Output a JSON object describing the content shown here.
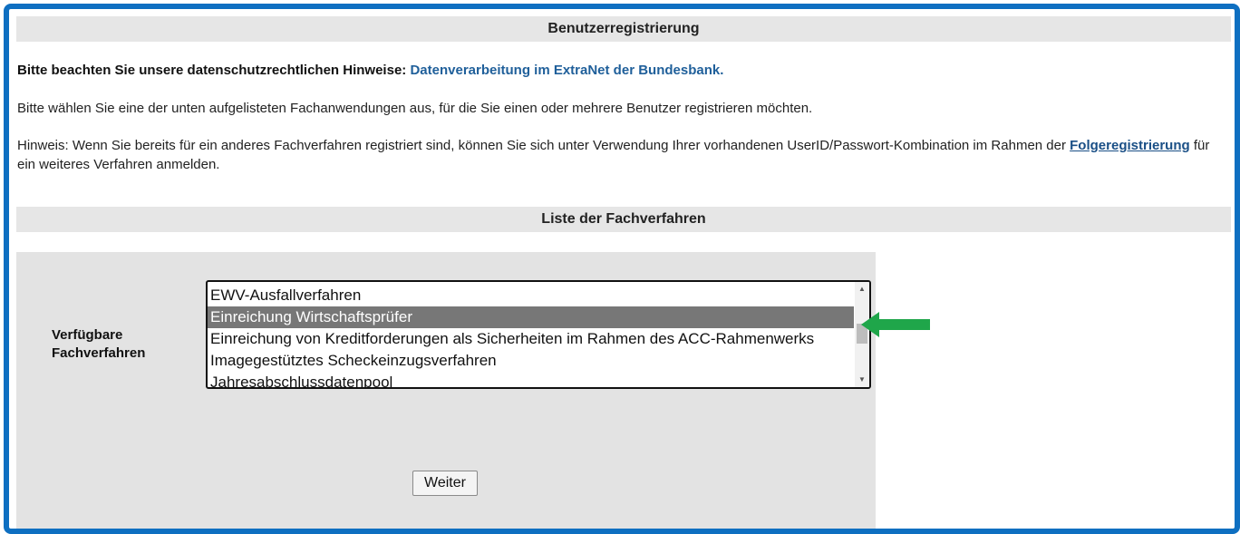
{
  "header": {
    "title": "Benutzerregistrierung"
  },
  "privacy": {
    "lead": "Bitte beachten Sie unsere datenschutzrechtlichen Hinweise:",
    "link": "Datenverarbeitung im ExtraNet der Bundesbank."
  },
  "intro": "Bitte wählen Sie eine der unten aufgelisteten Fachanwendungen aus, für die Sie einen oder mehrere Benutzer registrieren möchten.",
  "hint": {
    "before": "Hinweis: Wenn Sie bereits für ein anderes Fachverfahren registriert sind, können Sie sich unter Verwendung Ihrer vorhandenen UserID/Passwort-Kombination im Rahmen der ",
    "link": "Folgeregistrierung",
    "after": " für ein weiteres Verfahren anmelden."
  },
  "list_section": {
    "title": "Liste der Fachverfahren"
  },
  "form": {
    "label_line1": "Verfügbare",
    "label_line2": "Fachverfahren",
    "options": [
      "EWV-Ausfallverfahren",
      "Einreichung Wirtschaftsprüfer",
      "Einreichung von Kreditforderungen als Sicherheiten im Rahmen des ACC-Rahmenwerks",
      "Imagegestütztes Scheckeinzugsverfahren",
      "Jahresabschlussdatenpool"
    ],
    "selected_option": "Einreichung Wirtschaftsprüfer",
    "submit_label": "Weiter"
  },
  "colors": {
    "frame": "#0e6fc1",
    "header_bg": "#e6e6e6",
    "panel_bg": "#e3e3e3",
    "selected_bg": "#777777",
    "annotation_arrow": "#1fa64a",
    "link": "#1f5f9a"
  },
  "icons": {
    "annotation": "green-arrow-left-icon",
    "scroll_up": "scroll-up-arrow-icon",
    "scroll_down": "scroll-down-arrow-icon"
  }
}
